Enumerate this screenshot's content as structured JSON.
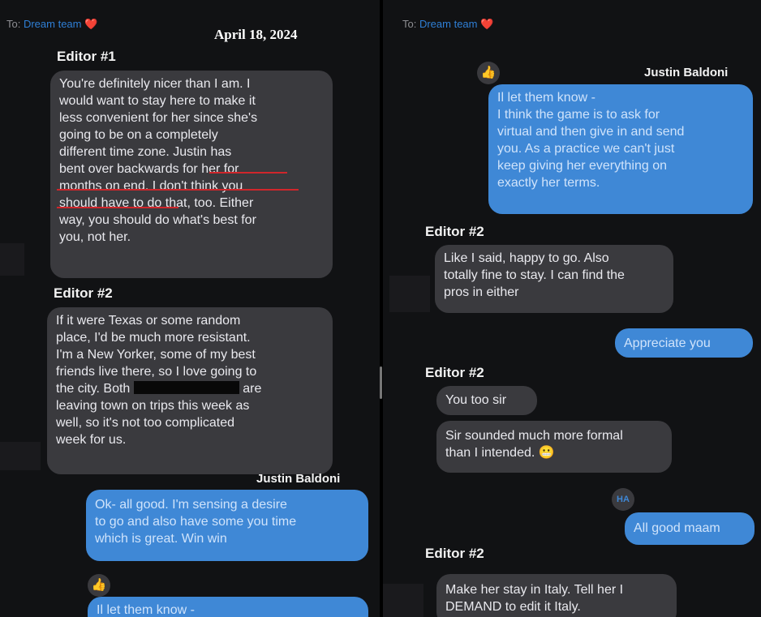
{
  "left": {
    "to_prefix": "To:",
    "to_name": "Dream team",
    "heart_icon": "❤️",
    "date": "April 18, 2024",
    "labels": {
      "editor1": "Editor #1",
      "editor2": "Editor #2",
      "justin": "Justin Baldoni"
    },
    "editor1_message": [
      "You're definitely nicer than I am. I",
      "would want to stay here to make it",
      "less convenient for her since she's",
      "going to be on a completely",
      "different time zone. Justin has",
      "bent over backwards for her for",
      "months on end. I don't think you",
      "should have to do that, too. Either",
      "way, you should do what's best for",
      "you, not her."
    ],
    "editor2_message": {
      "lines": [
        "If it were Texas or some random",
        "place, I'd be much more resistant.",
        "I'm a New Yorker, some of my best",
        "friends live there, so I love going to"
      ],
      "line5_before": "the city. Both",
      "line5_after": "are",
      "lines_after": [
        "leaving town on trips this week as",
        "well, so it's not too complicated",
        "week for us."
      ]
    },
    "justin_message": [
      "Ok- all good. I'm sensing a desire",
      "to go and also have some you time",
      "which is great. Win win"
    ],
    "reaction": "👍",
    "partial_message": "Il let them know -"
  },
  "right": {
    "to_prefix": "To:",
    "to_name": "Dream team",
    "heart_icon": "❤️",
    "labels": {
      "justin": "Justin Baldoni",
      "editor2_a": "Editor #2",
      "editor2_b": "Editor #2",
      "editor2_c": "Editor #2"
    },
    "reaction_thumb": "👍",
    "justin_message": [
      "Il let them know -",
      "I think the game is to ask for",
      "virtual and then give in and send",
      "you. As a practice we can't just",
      "keep giving her everything on",
      "exactly her terms."
    ],
    "editor2_reply1": [
      "Like I said, happy to go. Also",
      "totally fine to stay. I can find the",
      "pros in either"
    ],
    "appreciate": "Appreciate you",
    "you_too": "You too sir",
    "sir_formal": [
      "Sir sounded much more formal",
      "than I intended. 😬"
    ],
    "haha_reaction": "HA",
    "all_good": "All good maam",
    "final_message": [
      "Make her stay in Italy. Tell her I",
      "DEMAND to edit it Italy."
    ]
  }
}
